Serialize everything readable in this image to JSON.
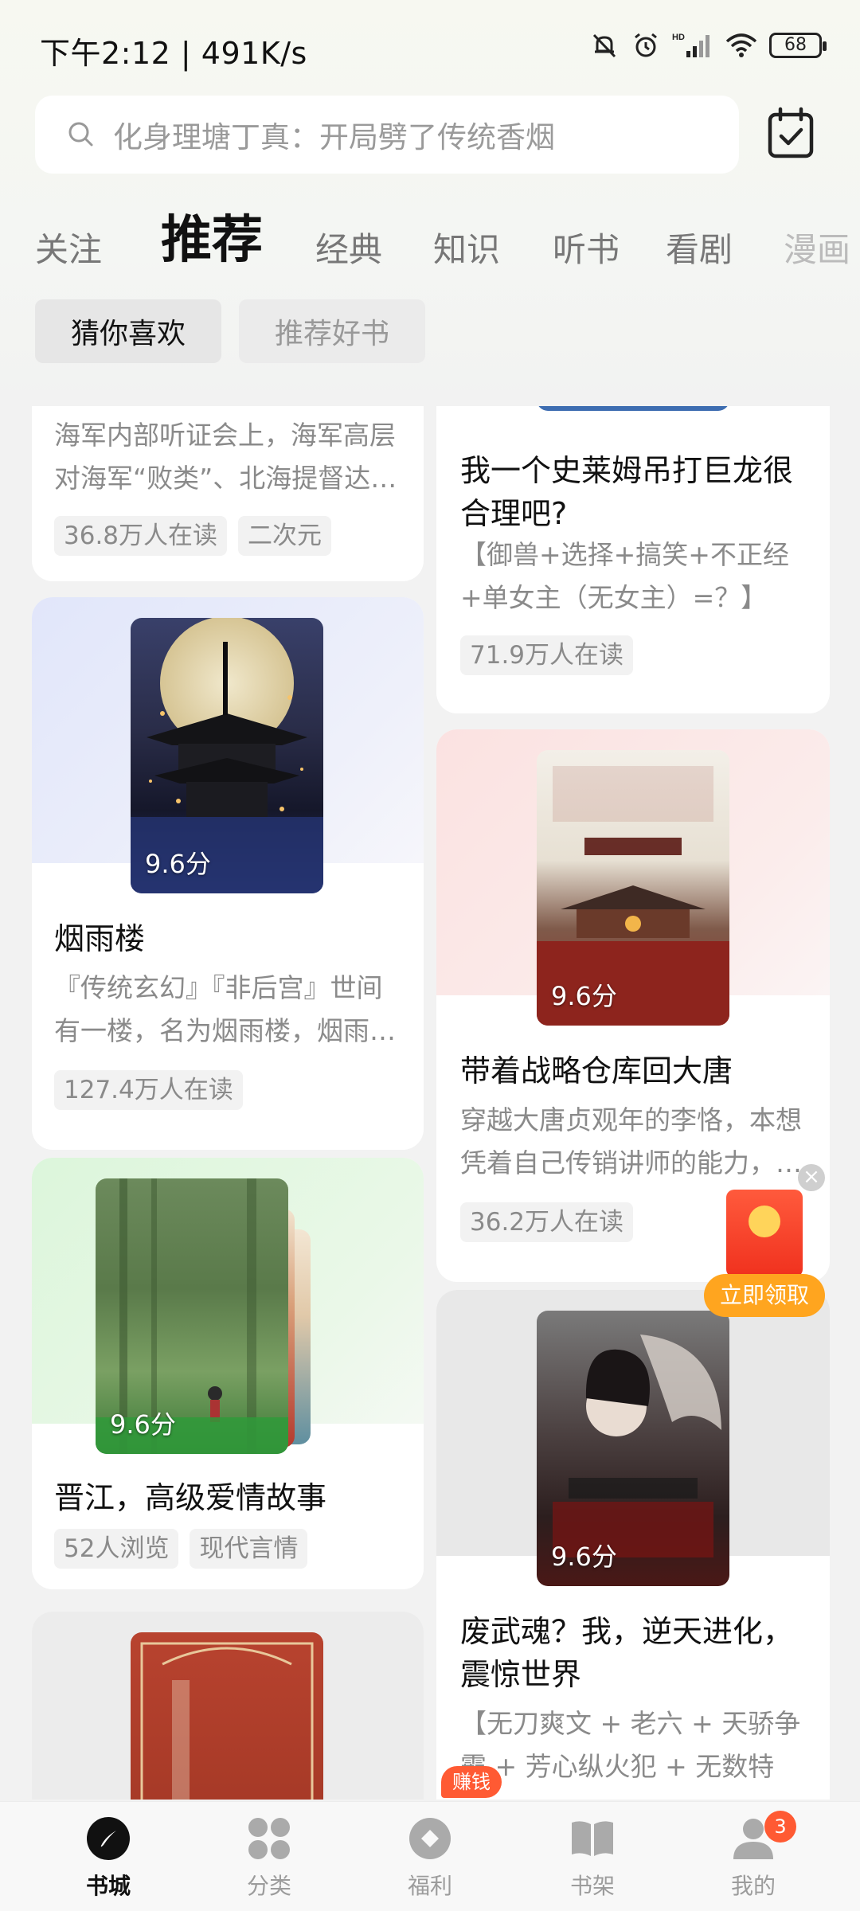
{
  "status_bar": {
    "time": "下午2:12 | 491K/s",
    "battery": "68",
    "network": "HD"
  },
  "search": {
    "placeholder": "化身理塘丁真：开局劈了传统香烟"
  },
  "tabs": [
    "关注",
    "推荐",
    "经典",
    "知识",
    "听书",
    "看剧",
    "漫画"
  ],
  "active_tab": "推荐",
  "subtabs": [
    "猜你喜欢",
    "推荐好书"
  ],
  "left_column": [
    {
      "desc": "海军内部听证会上，海军高层对海军“败类”、北海提督达…",
      "tags": [
        "36.8万人在读",
        "二次元"
      ]
    },
    {
      "title": "烟雨楼",
      "score": "9.6分",
      "desc": "『传统玄幻』『非后宫』世间有一楼，名为烟雨楼，烟雨…",
      "tags": [
        "127.4万人在读"
      ],
      "band_color": "#e2e7f8"
    },
    {
      "title": "晋江，高级爱情故事",
      "score": "9.6分",
      "tags": [
        "52人浏览",
        "现代言情"
      ],
      "band_color": "#e3f7e2"
    },
    {
      "band_color": "#ececec"
    }
  ],
  "right_column": [
    {
      "title": "我一个史莱姆吊打巨龙很合理吧?",
      "desc": "【御兽+选择+搞笑+不正经+单女主（无女主）=？】一…",
      "tags": [
        "71.9万人在读"
      ]
    },
    {
      "title": "带着战略仓库回大唐",
      "score": "9.6分",
      "desc": "穿越大唐贞观年的李恪，本想凭着自己传销讲师的能力，…",
      "tags": [
        "36.2万人在读"
      ],
      "band_color": "#fbe6e6"
    },
    {
      "title": "废武魂？我，逆天进化，震惊世界",
      "score": "9.6分",
      "desc": "【无刀爽文 + 老六 + 天骄争霸 + 芳心纵火犯 + 无数特殊“…",
      "band_color": "#e8e8e8"
    }
  ],
  "red_packet": {
    "close": "×",
    "button": "立即领取"
  },
  "bottom_nav": {
    "items": [
      "书城",
      "分类",
      "福利",
      "书架",
      "我的"
    ],
    "earn_badge": "赚钱",
    "me_badge": "3"
  },
  "colors": {
    "accent_orange": "#ffa51f",
    "badge_red": "#ff5a33"
  }
}
